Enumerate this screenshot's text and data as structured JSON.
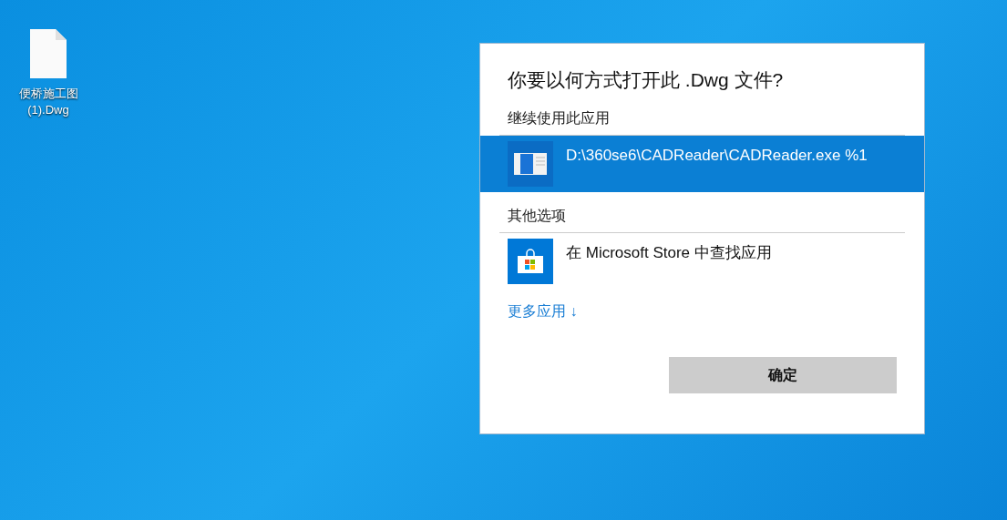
{
  "desktop_icons": [
    {
      "label": "便桥施工图(1).Dwg"
    }
  ],
  "dialog": {
    "title": "你要以何方式打开此 .Dwg 文件?",
    "sections": [
      {
        "heading": "继续使用此应用",
        "items": [
          {
            "kind": "app",
            "label": "D:\\360se6\\CADReader\\CADReader.exe %1",
            "selected": true
          }
        ]
      },
      {
        "heading": "其他选项",
        "items": [
          {
            "kind": "store",
            "label": "在 Microsoft Store 中查找应用",
            "selected": false
          }
        ]
      }
    ],
    "more_link": "更多应用 ↓",
    "ok_button": "确定"
  }
}
